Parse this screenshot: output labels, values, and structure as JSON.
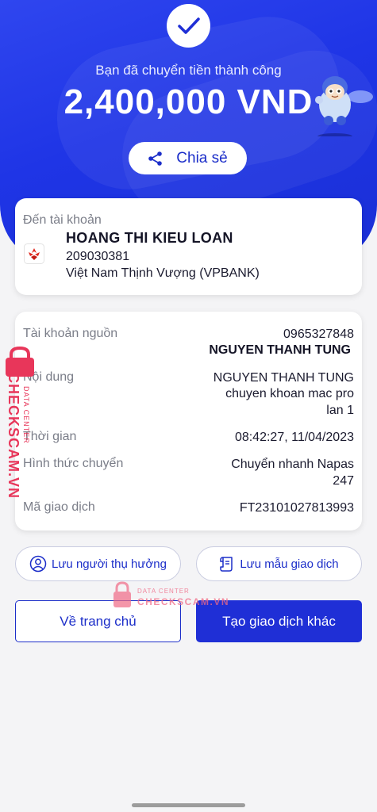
{
  "hero": {
    "title": "Bạn đã chuyển tiền thành công",
    "amount": "2,400,000 VND",
    "share_label": "Chia sẻ"
  },
  "destination": {
    "label": "Đến tài khoản",
    "name": "HOANG THI KIEU LOAN",
    "account": "209030381",
    "bank": "Việt Nam Thịnh Vượng (VPBANK)"
  },
  "details": {
    "source_label": "Tài khoản nguồn",
    "source_account": "0965327848",
    "source_name": "NGUYEN THANH TUNG",
    "content_label": "Nội dung",
    "content_line1": "NGUYEN THANH TUNG",
    "content_line2": "chuyen khoan mac pro",
    "content_line3": "lan 1",
    "time_label": "Thời gian",
    "time_value": "08:42:27, 11/04/2023",
    "method_label": "Hình thức chuyển",
    "method_line1": "Chuyển nhanh Napas",
    "method_line2": "247",
    "txid_label": "Mã giao dịch",
    "txid_value": "FT23101027813993"
  },
  "actions": {
    "save_beneficiary": "Lưu người thụ hưởng",
    "save_template": "Lưu mẫu giao dịch",
    "home": "Về trang chủ",
    "new_transaction": "Tạo giao dịch khác"
  },
  "watermark": {
    "brand": "CHECKSCAM.VN",
    "sub": "DATA CENTER"
  },
  "colors": {
    "primary": "#1f2fd6",
    "hero_blue": "#2f46ef",
    "watermark": "#e8365a"
  }
}
